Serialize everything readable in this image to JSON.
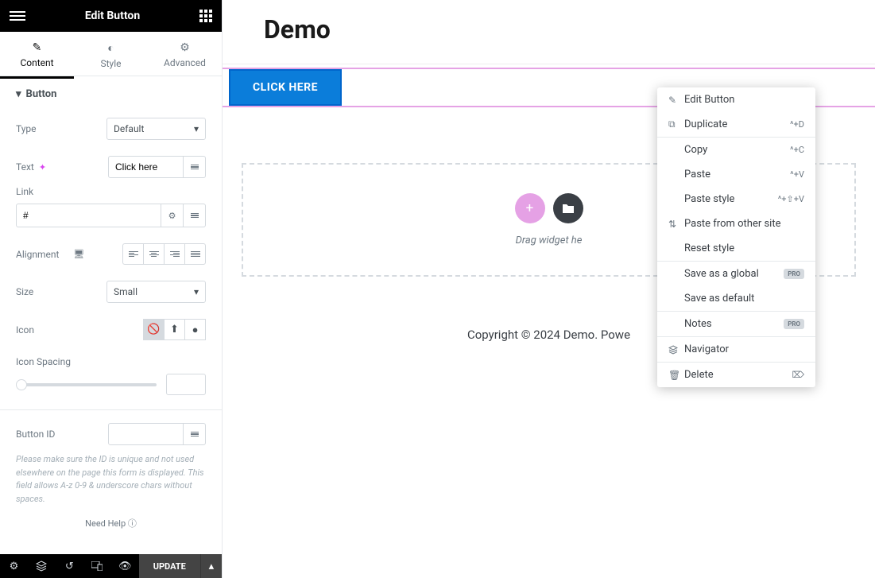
{
  "header": {
    "title": "Edit Button"
  },
  "tabs": {
    "content": "Content",
    "style": "Style",
    "advanced": "Advanced"
  },
  "section": {
    "title": "Button"
  },
  "controls": {
    "type_label": "Type",
    "type_value": "Default",
    "text_label": "Text",
    "text_value": "Click here",
    "link_label": "Link",
    "link_value": "#",
    "alignment_label": "Alignment",
    "size_label": "Size",
    "size_value": "Small",
    "icon_label": "Icon",
    "icon_spacing_label": "Icon Spacing",
    "button_id_label": "Button ID"
  },
  "help_text": "Please make sure the ID is unique and not used elsewhere on the page this form is displayed. This field allows A-z 0-9 & underscore chars without spaces.",
  "need_help": "Need Help",
  "footer": {
    "update": "UPDATE"
  },
  "canvas": {
    "title": "Demo",
    "button_text": "CLICK HERE",
    "drop_text": "Drag widget he",
    "copyright": "Copyright © 2024 Demo. Powe"
  },
  "context_menu": {
    "edit": "Edit Button",
    "duplicate": "Duplicate",
    "duplicate_sc": "^+D",
    "copy": "Copy",
    "copy_sc": "^+C",
    "paste": "Paste",
    "paste_sc": "^+V",
    "paste_style": "Paste style",
    "paste_style_sc": "^+⇧+V",
    "paste_other": "Paste from other site",
    "reset_style": "Reset style",
    "save_global": "Save as a global",
    "save_default": "Save as default",
    "notes": "Notes",
    "navigator": "Navigator",
    "delete": "Delete",
    "pro": "PRO"
  }
}
